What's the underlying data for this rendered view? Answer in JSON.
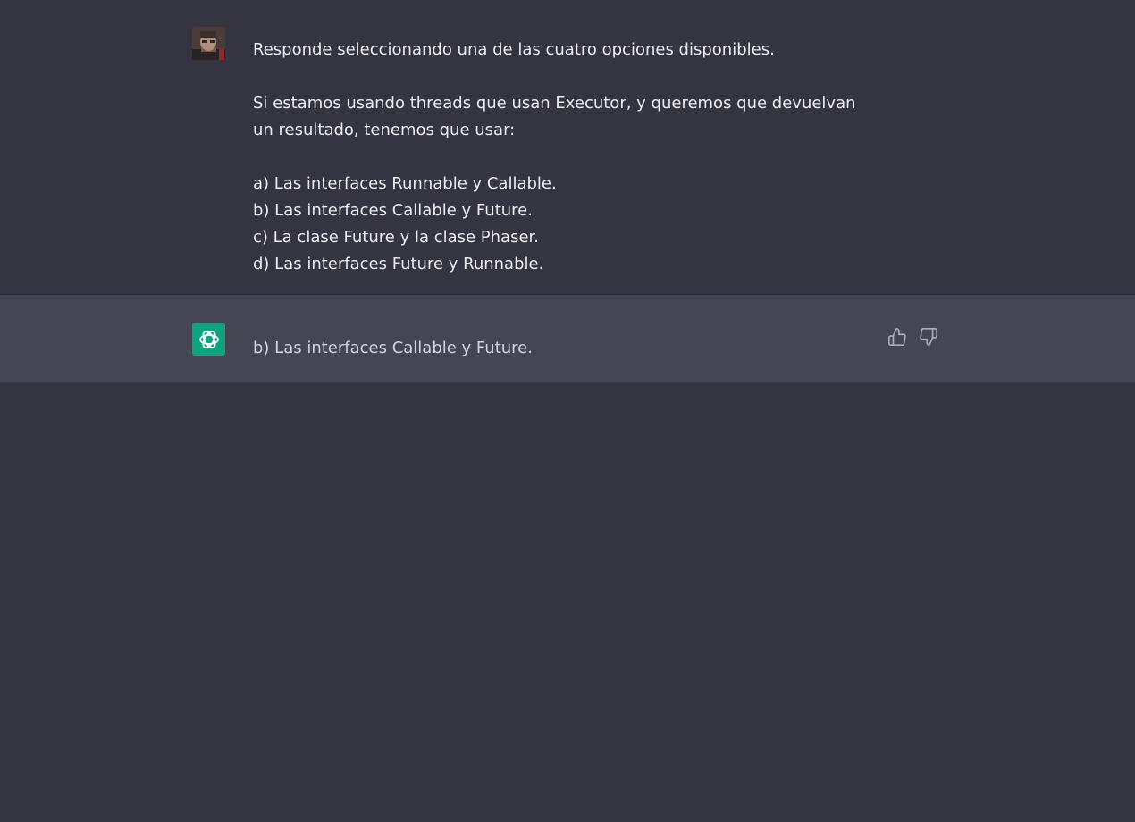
{
  "conversation": {
    "user_message": {
      "intro": "Responde seleccionando una de las cuatro opciones disponibles.",
      "question": "Si estamos usando threads que usan Executor, y queremos que devuelvan un resultado, tenemos que usar:",
      "options": [
        "a) Las interfaces Runnable y Callable.",
        "b) Las interfaces Callable y Future.",
        "c) La clase Future y la clase Phaser.",
        "d) Las interfaces Future y Runnable."
      ]
    },
    "assistant_message": {
      "text": "b) Las interfaces Callable y Future."
    }
  },
  "icons": {
    "user_avatar": "user-avatar-photo",
    "assistant_avatar": "openai-logo-icon",
    "thumbs_up": "thumbs-up-icon",
    "thumbs_down": "thumbs-down-icon"
  },
  "colors": {
    "background": "#343541",
    "assistant_background": "#444654",
    "brand_green": "#10a37f",
    "text": "#ececf1",
    "muted_text": "#d1d5db",
    "icon": "#acacbe"
  }
}
